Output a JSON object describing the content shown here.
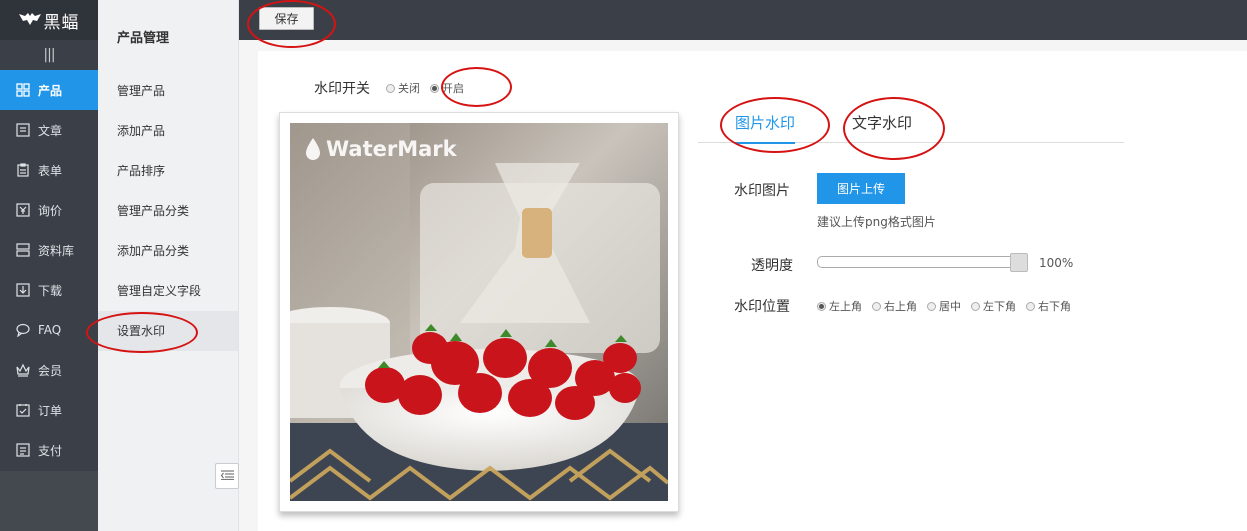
{
  "brand": {
    "name": "黑蝠",
    "icon": "bat-logo-icon"
  },
  "nav": {
    "items": [
      {
        "label": "产品",
        "icon": "grid-icon",
        "active": true
      },
      {
        "label": "文章",
        "icon": "article-icon",
        "active": false
      },
      {
        "label": "表单",
        "icon": "clipboard-icon",
        "active": false
      },
      {
        "label": "询价",
        "icon": "yen-icon",
        "active": false
      },
      {
        "label": "资料库",
        "icon": "database-icon",
        "active": false
      },
      {
        "label": "下载",
        "icon": "download-icon",
        "active": false
      },
      {
        "label": "FAQ",
        "icon": "chat-icon",
        "active": false
      },
      {
        "label": "会员",
        "icon": "crown-icon",
        "active": false
      },
      {
        "label": "订单",
        "icon": "order-icon",
        "active": false
      },
      {
        "label": "支付",
        "icon": "payment-icon",
        "active": false
      }
    ]
  },
  "submenu": {
    "title": "产品管理",
    "items": [
      {
        "label": "管理产品"
      },
      {
        "label": "添加产品"
      },
      {
        "label": "产品排序"
      },
      {
        "label": "管理产品分类"
      },
      {
        "label": "添加产品分类"
      },
      {
        "label": "管理自定义字段"
      },
      {
        "label": "设置水印",
        "active": true
      }
    ]
  },
  "toolbar": {
    "save_label": "保存"
  },
  "watermark": {
    "switch_label": "水印开关",
    "off_label": "关闭",
    "on_label": "开启",
    "enabled": true,
    "preview_text": "WaterMark",
    "tabs": [
      {
        "label": "图片水印",
        "active": true
      },
      {
        "label": "文字水印",
        "active": false
      }
    ],
    "image_label": "水印图片",
    "upload_label": "图片上传",
    "upload_hint": "建议上传png格式图片",
    "opacity_label": "透明度",
    "opacity_value": "100%",
    "opacity_fraction": 1.0,
    "position_label": "水印位置",
    "positions": [
      "左上角",
      "右上角",
      "居中",
      "左下角",
      "右下角"
    ],
    "selected_position": "左上角"
  },
  "colors": {
    "accent": "#2196e9",
    "nav_bg": "#3b4048",
    "annotation_red": "#d61313"
  }
}
